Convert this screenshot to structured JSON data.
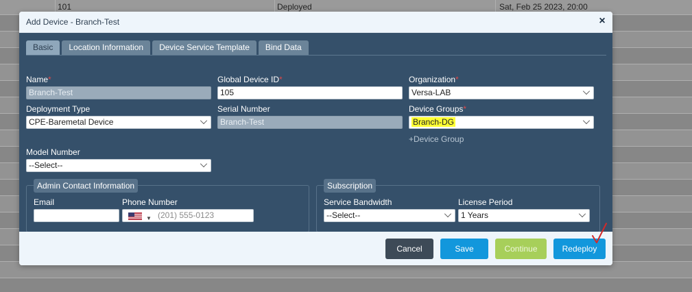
{
  "background": {
    "row1": {
      "c1": "101",
      "c2": "Deployed",
      "c3": "Sat, Feb 25 2023, 20:00"
    }
  },
  "modal": {
    "title": "Add Device - Branch-Test",
    "close_glyph": "×",
    "tabs": [
      {
        "label": "Basic",
        "active": true
      },
      {
        "label": "Location Information",
        "active": false
      },
      {
        "label": "Device Service Template",
        "active": false
      },
      {
        "label": "Bind Data",
        "active": false
      }
    ],
    "fields": {
      "name": {
        "label": "Name",
        "required": "*",
        "value": "Branch-Test"
      },
      "global_device_id": {
        "label": "Global Device ID",
        "required": "*",
        "value": "105"
      },
      "organization": {
        "label": "Organization",
        "required": "*",
        "value": "Versa-LAB"
      },
      "deployment_type": {
        "label": "Deployment Type",
        "value": "CPE-Baremetal Device"
      },
      "serial_number": {
        "label": "Serial Number",
        "value": "Branch-Test"
      },
      "device_groups": {
        "label": "Device Groups",
        "required": "*",
        "value": "Branch-DG"
      },
      "add_device_group": "+Device Group",
      "model_number": {
        "label": "Model Number",
        "value": "--Select--"
      }
    },
    "admin_contact": {
      "legend": "Admin Contact Information",
      "email": {
        "label": "Email",
        "value": ""
      },
      "phone": {
        "label": "Phone Number",
        "placeholder": "(201) 555-0123",
        "country": "us-flag-icon"
      }
    },
    "subscription": {
      "legend": "Subscription",
      "service_bandwidth": {
        "label": "Service Bandwidth",
        "value": "--Select--"
      },
      "license_period": {
        "label": "License Period",
        "value": "1 Years"
      }
    },
    "footer": {
      "cancel": "Cancel",
      "save": "Save",
      "continue": "Continue",
      "redeploy": "Redeploy"
    },
    "colors": {
      "body_bg": "#35506a",
      "accent": "#1297dc",
      "continue": "#a7cf5a",
      "cancel": "#3d4a57",
      "highlight": "#ffff33"
    }
  }
}
